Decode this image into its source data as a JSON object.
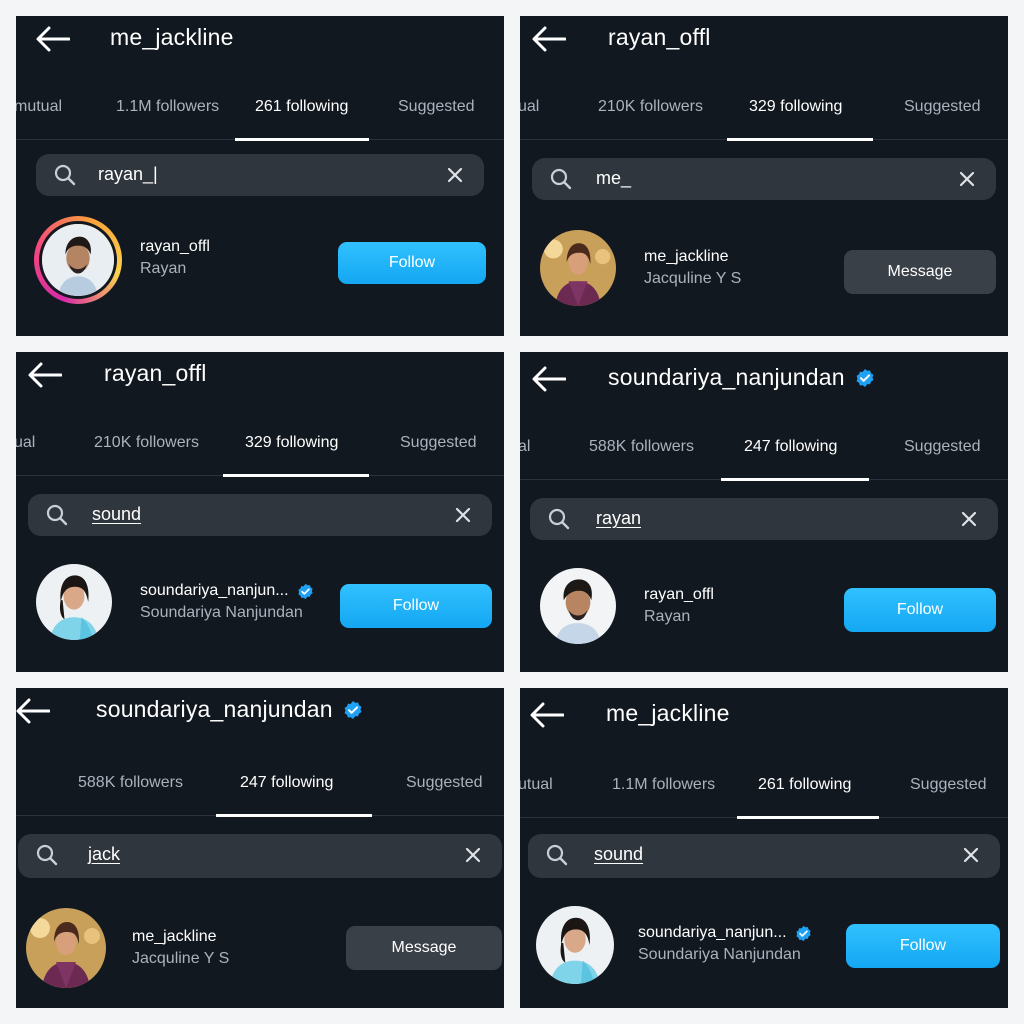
{
  "colors": {
    "panel_bg": "#121820",
    "search_bg": "#30363e",
    "follow_button": "#1fb3f8",
    "message_button": "#3a4048",
    "verified_badge": "#1ea1f2",
    "muted_text": "#aab2bc"
  },
  "icons": {
    "back": "arrow-left-icon",
    "search": "search-icon",
    "clear": "close-icon",
    "verified": "verified-badge-icon"
  },
  "panels": [
    {
      "title": "me_jackline",
      "verified": false,
      "tabs": [
        "mutual",
        "1.1M followers",
        "261 following",
        "Suggested"
      ],
      "active_tab": 2,
      "search": {
        "value": "rayan_|",
        "underlined": false
      },
      "result": {
        "username": "rayan_offl",
        "name": "Rayan",
        "verified": false,
        "story_ring": true,
        "button": "Follow"
      }
    },
    {
      "title": "rayan_offl",
      "verified": false,
      "tabs": [
        "ual",
        "210K followers",
        "329 following",
        "Suggested"
      ],
      "active_tab": 2,
      "search": {
        "value": "me_",
        "underlined": false
      },
      "result": {
        "username": "me_jackline",
        "name": "Jacquline Y S",
        "verified": false,
        "story_ring": false,
        "button": "Message"
      }
    },
    {
      "title": "rayan_offl",
      "verified": false,
      "tabs": [
        "ual",
        "210K followers",
        "329 following",
        "Suggested"
      ],
      "active_tab": 2,
      "search": {
        "value": "sound",
        "underlined": true
      },
      "result": {
        "username": "soundariya_nanjun...",
        "name": "Soundariya Nanjundan",
        "verified": true,
        "story_ring": false,
        "button": "Follow"
      }
    },
    {
      "title": "soundariya_nanjundan",
      "verified": true,
      "tabs": [
        "al",
        "588K followers",
        "247 following",
        "Suggested"
      ],
      "active_tab": 2,
      "search": {
        "value": "rayan",
        "underlined": true
      },
      "result": {
        "username": "rayan_offl",
        "name": "Rayan",
        "verified": false,
        "story_ring": false,
        "button": "Follow"
      }
    },
    {
      "title": "soundariya_nanjundan",
      "verified": true,
      "tabs": [
        "",
        "588K followers",
        "247 following",
        "Suggested"
      ],
      "active_tab": 2,
      "search": {
        "value": "jack",
        "underlined": true
      },
      "result": {
        "username": "me_jackline",
        "name": "Jacquline Y S",
        "verified": false,
        "story_ring": false,
        "button": "Message"
      }
    },
    {
      "title": "me_jackline",
      "verified": false,
      "tabs": [
        "utual",
        "1.1M followers",
        "261 following",
        "Suggested"
      ],
      "active_tab": 2,
      "search": {
        "value": "sound",
        "underlined": true
      },
      "result": {
        "username": "soundariya_nanjun...",
        "name": "Soundariya Nanjundan",
        "verified": true,
        "story_ring": false,
        "button": "Follow"
      }
    }
  ]
}
